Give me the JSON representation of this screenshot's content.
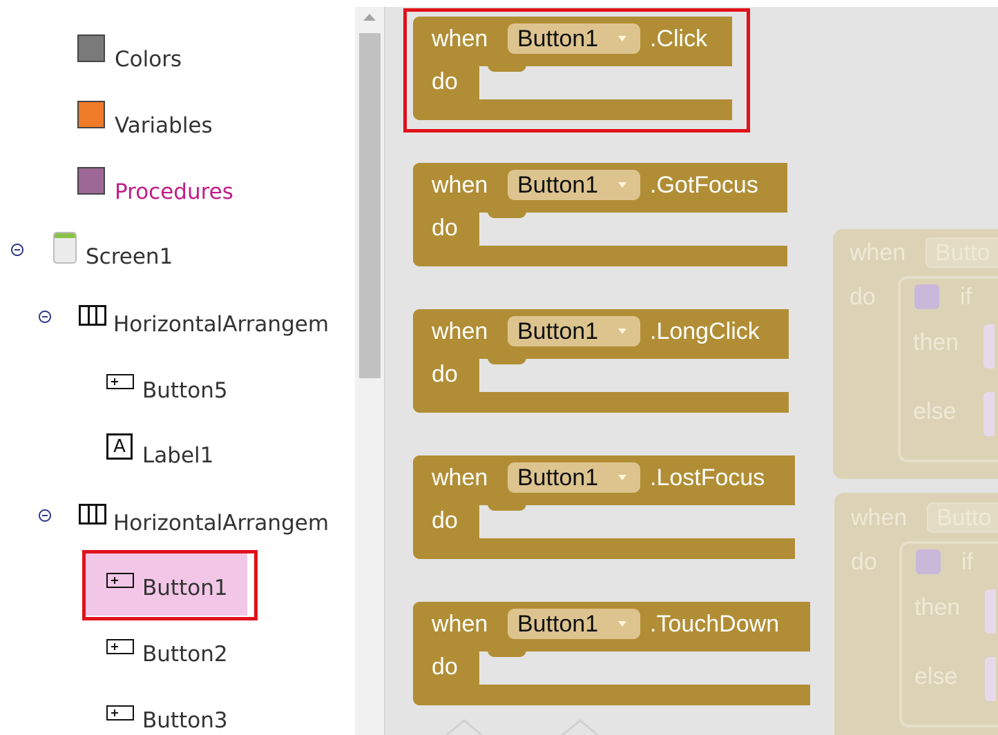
{
  "tree": {
    "builtins": [
      {
        "label": "Colors",
        "color": "#7a7a7a",
        "label_color": "#333333"
      },
      {
        "label": "Variables",
        "color": "#ef7a28",
        "label_color": "#333333"
      },
      {
        "label": "Procedures",
        "color": "#9d6896",
        "label_color": "#c01d87"
      }
    ],
    "screen": {
      "label": "Screen1"
    },
    "arrangements": [
      {
        "label": "HorizontalArrangem"
      },
      {
        "label": "HorizontalArrangem"
      }
    ],
    "components": [
      {
        "label": "Button5",
        "icon": "button-icon"
      },
      {
        "label": "Label1",
        "icon": "label-icon",
        "glyph": "A"
      },
      {
        "label": "Button1",
        "icon": "button-icon",
        "selected": true
      },
      {
        "label": "Button2",
        "icon": "button-icon"
      },
      {
        "label": "Button3",
        "icon": "button-icon"
      }
    ]
  },
  "workspace": {
    "blocks": [
      {
        "when": "when",
        "component": "Button1",
        "event": ".Click",
        "do": "do"
      },
      {
        "when": "when",
        "component": "Button1",
        "event": ".GotFocus",
        "do": "do"
      },
      {
        "when": "when",
        "component": "Button1",
        "event": ".LongClick",
        "do": "do"
      },
      {
        "when": "when",
        "component": "Button1",
        "event": ".LostFocus",
        "do": "do"
      },
      {
        "when": "when",
        "component": "Button1",
        "event": ".TouchDown",
        "do": "do"
      }
    ],
    "ghost_blocks": [
      {
        "when": "when",
        "component": "Butto",
        "do": "do",
        "if": "if",
        "then": "then",
        "else": "else"
      },
      {
        "when": "when",
        "component": "Butto",
        "do": "do",
        "if": "if",
        "then": "then",
        "else": "else"
      }
    ]
  },
  "colors": {
    "block": "#b18e35",
    "dropdown": "#ddc48f",
    "highlight": "#e0121b",
    "selection": "#f2c6e6",
    "workspace": "#e4e4e4"
  }
}
